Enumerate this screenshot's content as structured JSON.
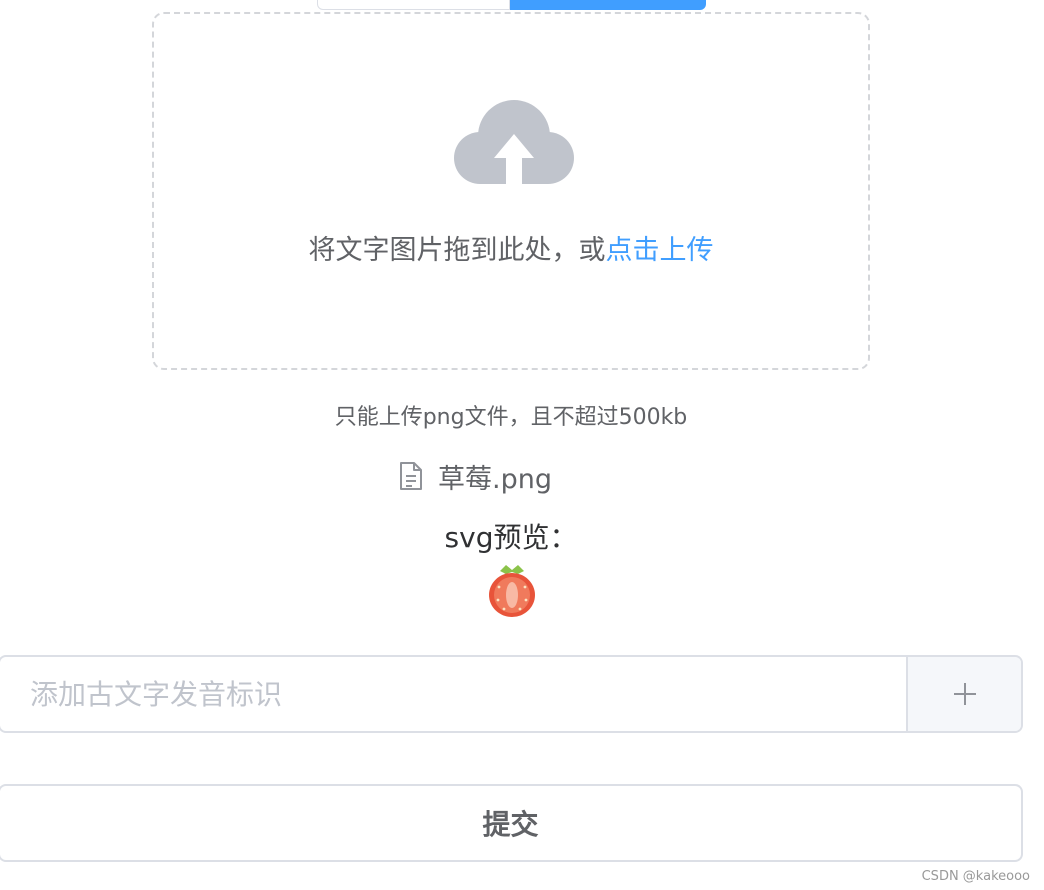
{
  "upload": {
    "icon": "upload-cloud-icon",
    "drop_text": "将文字图片拖到此处，或",
    "click_text": "点击上传",
    "tip": "只能上传png文件，且不超过500kb"
  },
  "file_list": [
    {
      "icon": "document-icon",
      "name": "草莓.png"
    }
  ],
  "preview": {
    "label": "svg预览：",
    "image": "strawberry"
  },
  "pronunciation": {
    "placeholder": "添加古文字发音标识",
    "value": "",
    "append_icon": "plus-icon"
  },
  "submit": {
    "label": "提交"
  },
  "watermark": "CSDN @kakeooo",
  "colors": {
    "accent": "#409eff",
    "border": "#dcdfe6",
    "icon_gray": "#c0c4cc",
    "text": "#606266"
  }
}
